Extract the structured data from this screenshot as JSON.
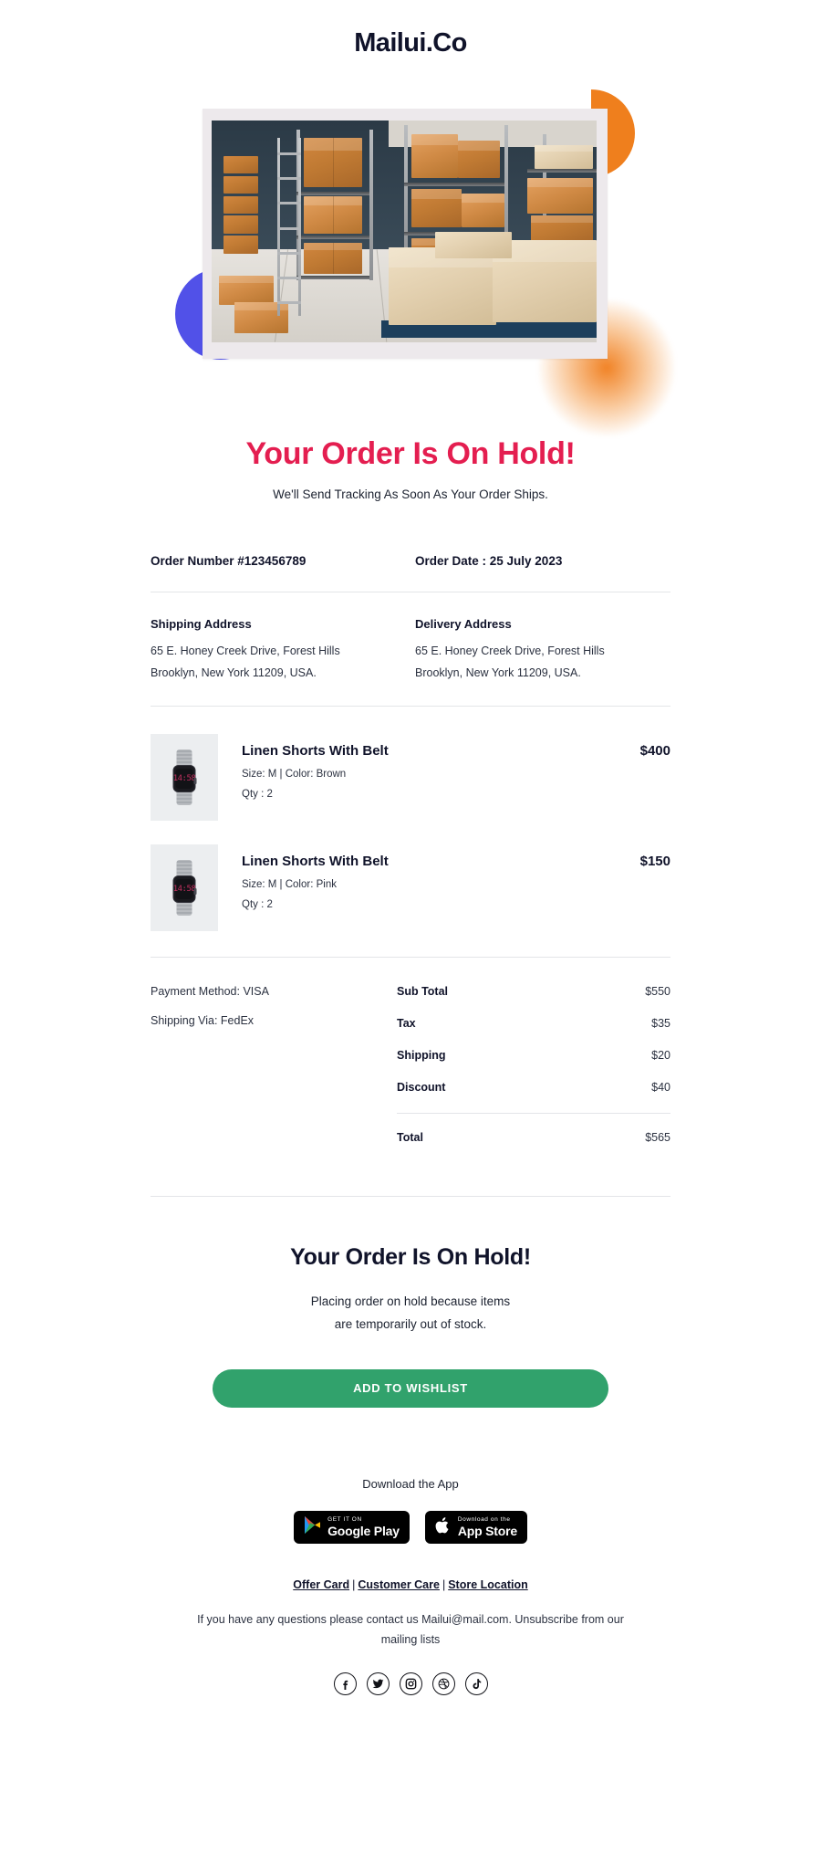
{
  "brand": {
    "logo": "Mailui.Co"
  },
  "hero": {
    "image_alt": "warehouse-shelves-with-cardboard-boxes",
    "colors": {
      "orange": "#ef7f1d",
      "blue": "#5151e8",
      "frame": "#ede9ec"
    }
  },
  "headline": {
    "title": "Your Order Is On Hold!",
    "subtitle": "We'll Send Tracking As Soon As Your Order Ships.",
    "color": "#e41e50"
  },
  "order": {
    "number_label": "Order Number #123456789",
    "date_label": "Order Date : 25 July 2023"
  },
  "addresses": {
    "shipping": {
      "title": "Shipping Address",
      "line1": "65 E. Honey Creek Drive, Forest Hills",
      "line2": "Brooklyn, New York 11209, USA."
    },
    "delivery": {
      "title": "Delivery Address",
      "line1": "65 E. Honey Creek Drive, Forest Hills",
      "line2": "Brooklyn, New York 11209, USA."
    }
  },
  "items": [
    {
      "name": "Linen Shorts With Belt",
      "meta": "Size: M | Color: Brown",
      "qty": "Qty : 2",
      "price": "$400",
      "thumb_alt": "smartwatch-product-photo",
      "watch_time": "14:58"
    },
    {
      "name": "Linen Shorts With Belt",
      "meta": "Size: M | Color: Pink",
      "qty": "Qty : 2",
      "price": "$150",
      "thumb_alt": "smartwatch-product-photo",
      "watch_time": "14:58"
    }
  ],
  "payment": {
    "method": "Payment Method: VISA",
    "shipping_via": "Shipping Via: FedEx"
  },
  "totals": {
    "rows": [
      {
        "label": "Sub Total",
        "value": "$550"
      },
      {
        "label": "Tax",
        "value": "$35"
      },
      {
        "label": "Shipping",
        "value": "$20"
      },
      {
        "label": "Discount",
        "value": "$40"
      }
    ],
    "grand": {
      "label": "Total",
      "value": "$565"
    }
  },
  "cta": {
    "title": "Your Order Is On Hold!",
    "line1": "Placing order on hold because items",
    "line2": "are temporarily out of stock.",
    "button": "ADD TO WISHLIST",
    "button_color": "#31a26c"
  },
  "app": {
    "title": "Download the App",
    "google": {
      "small": "GET IT ON",
      "big": "Google Play",
      "icon": "google-play-icon"
    },
    "apple": {
      "small": "Download on the",
      "big": "App Store",
      "icon": "apple-icon"
    }
  },
  "footer": {
    "links": [
      {
        "label": "Offer Card"
      },
      {
        "label": "Customer Care"
      },
      {
        "label": "Store Location"
      }
    ],
    "separator": "|",
    "contact": "If you have any questions please contact us Mailui@mail.com. Unsubscribe from our mailing lists",
    "socials": [
      {
        "name": "facebook-icon"
      },
      {
        "name": "twitter-icon"
      },
      {
        "name": "instagram-icon"
      },
      {
        "name": "dribbble-icon"
      },
      {
        "name": "tiktok-icon"
      }
    ]
  }
}
